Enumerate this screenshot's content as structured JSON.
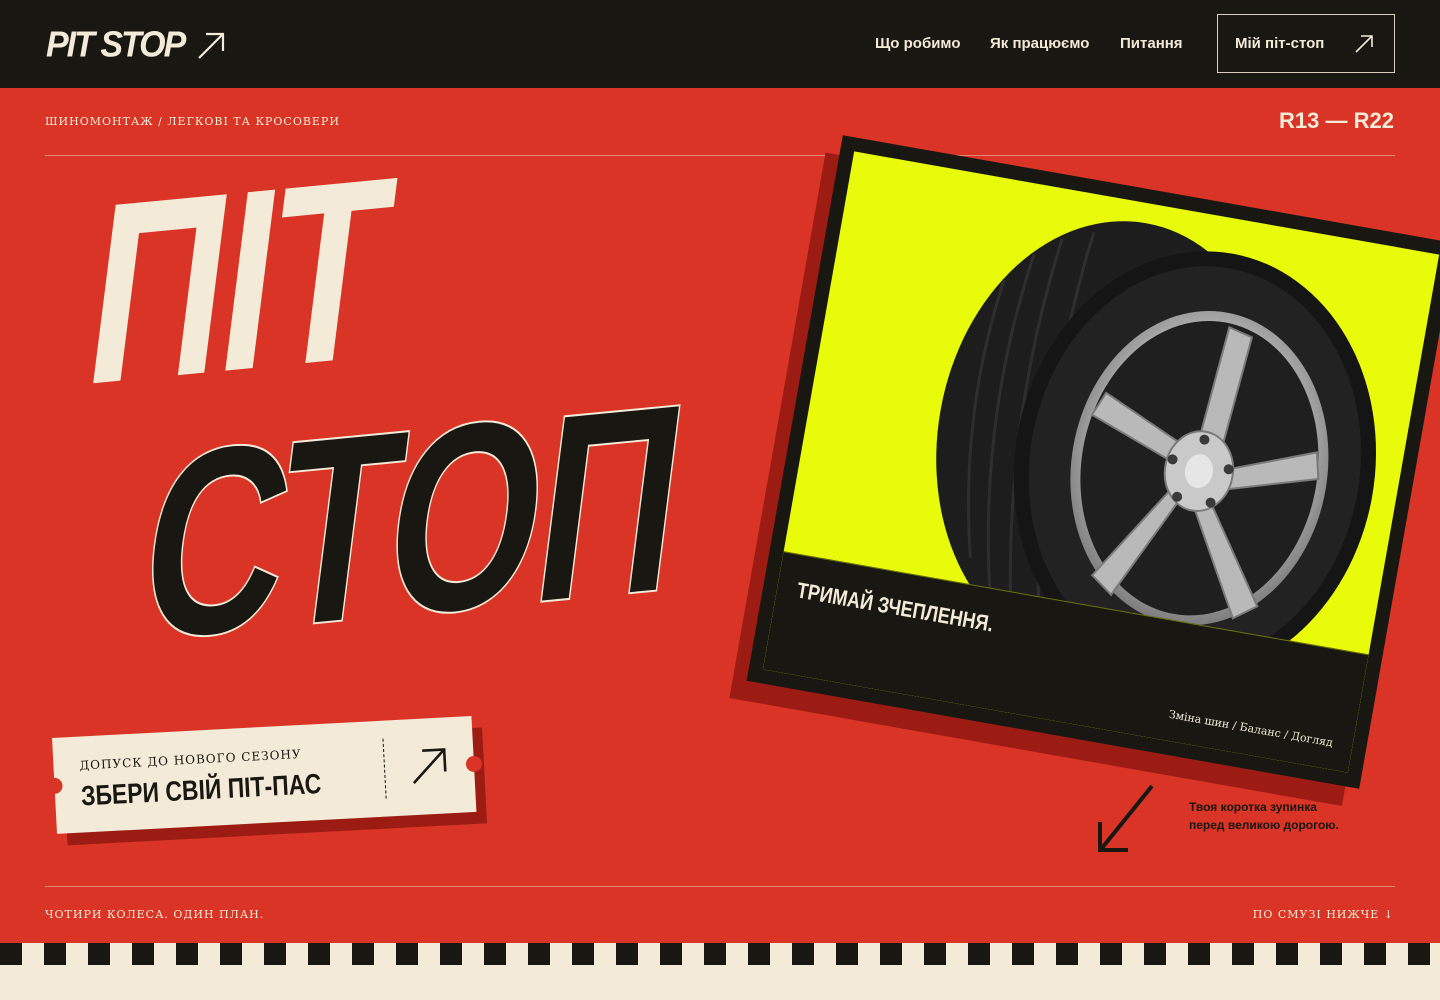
{
  "brand": {
    "logo": "PIT STOP"
  },
  "nav": {
    "links": [
      "Що робимо",
      "Як працюємо",
      "Питання"
    ],
    "cta_label": "Мій піт-стоп"
  },
  "subheader": {
    "breadcrumb": "ШИНОМОНТАЖ / ЛЕГКОВІ ТА КРОСОВЕРИ",
    "size_range": "R13 — R22"
  },
  "hero": {
    "line1": "ПІТ",
    "line2": "СТОП"
  },
  "ticket": {
    "small": "ДОПУСК ДО НОВОГО СЕЗОНУ",
    "title": "ЗБЕРИ СВІЙ ПІТ-ПАС"
  },
  "card": {
    "title": "ТРИМАЙ ЗЧЕПЛЕННЯ.",
    "tags": "Зміна шин / Баланс / Догляд"
  },
  "note": {
    "line1": "Твоя коротка зупинка",
    "line2": "перед великою дорогою."
  },
  "footer": {
    "left": "ЧОТИРИ КОЛЕСА. ОДИН ПЛАН.",
    "right": "ПО СМУЗІ НИЖЧЕ ↓"
  },
  "colors": {
    "background": "#d93425",
    "dark": "#181712",
    "cream": "#f3ead7",
    "accent_yellow": "#e7fb0a"
  },
  "icons": [
    "arrow-up-right-icon",
    "arrow-down-left-icon",
    "tire-image"
  ]
}
